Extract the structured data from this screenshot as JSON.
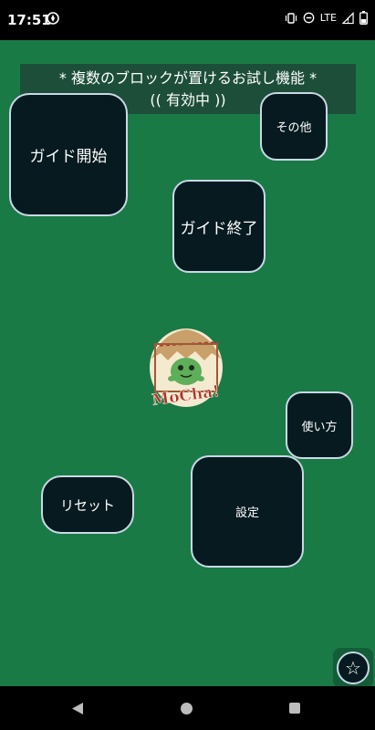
{
  "status_bar": {
    "time": "17:51",
    "network_label": "LTE",
    "icons": [
      "data-saver-icon",
      "vibrate-icon",
      "do-not-disturb-icon",
      "signal-icon",
      "battery-icon"
    ]
  },
  "banner": {
    "line1": "* 複数のブロックが置けるお試し機能 *",
    "line2": "(( 有効中 ))"
  },
  "buttons": {
    "guide_start": "ガイド開始",
    "other": "その他",
    "guide_end": "ガイド終了",
    "howto": "使い方",
    "reset": "リセット",
    "settings": "設定"
  },
  "logo": {
    "text": "MoCha!"
  },
  "star_button": {
    "icon": "star-icon",
    "glyph": "☆"
  },
  "nav_bar": {
    "icons": [
      "back-icon",
      "home-icon",
      "recent-apps-icon"
    ]
  },
  "colors": {
    "background": "#1a7a45",
    "tile_fill": "#061a20",
    "tile_border": "#c9d8e6",
    "banner_bg": "#1e4637"
  }
}
